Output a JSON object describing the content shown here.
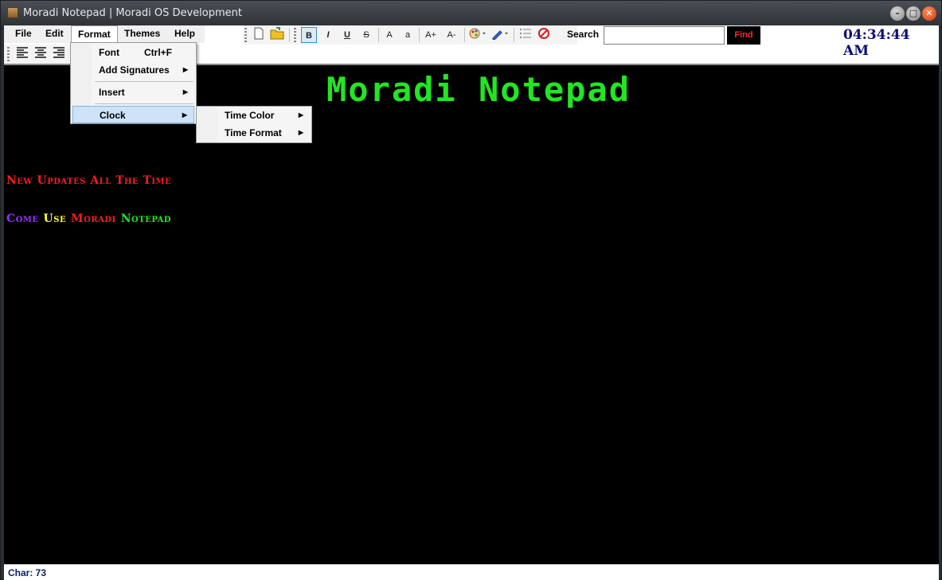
{
  "window": {
    "title": "Moradi Notepad | Moradi OS Development",
    "minimize_glyph": "–",
    "maximize_glyph": "□",
    "close_glyph": "✕"
  },
  "menubar": {
    "items": [
      {
        "label": "File"
      },
      {
        "label": "Edit"
      },
      {
        "label": "Format"
      },
      {
        "label": "Themes"
      },
      {
        "label": "Help"
      }
    ]
  },
  "toolbar": {
    "bold": "B",
    "italic": "I",
    "underline": "U",
    "strike": "S",
    "font_upper": "A",
    "font_lower": "a",
    "grow": "A+",
    "shrink": "A-",
    "search_label": "Search",
    "search_value": "",
    "find_label": "Find",
    "clock": "04:34:44 AM"
  },
  "format_menu": {
    "font": "Font",
    "font_shortcut": "Ctrl+F",
    "add_signatures": "Add Signatures",
    "insert": "Insert",
    "clock": "Clock"
  },
  "clock_menu": {
    "time_color": "Time Color",
    "time_format": "Time Format"
  },
  "editor": {
    "heading": "Moradi Notepad",
    "line1": "New Updates All The Time",
    "line2": [
      {
        "text": "Come",
        "color": "#9b30ff"
      },
      {
        "text": "Use",
        "color": "#ffff33"
      },
      {
        "text": "Moradi",
        "color": "#ff1a1a"
      },
      {
        "text": "Notepad",
        "color": "#22e622"
      }
    ]
  },
  "status": {
    "char_count": "Char: 73"
  },
  "colors": {
    "heading": "#22e622",
    "line1": "#ff1a1a",
    "clock": "#0a0a7a",
    "find_text": "#ff2a2a"
  }
}
